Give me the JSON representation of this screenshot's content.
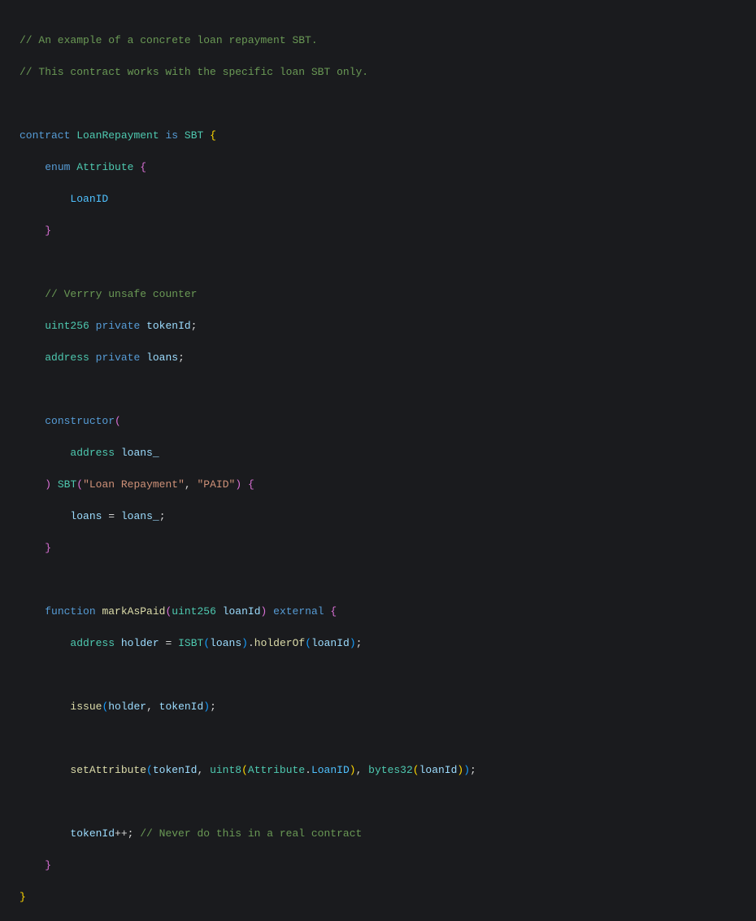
{
  "lines": {
    "c1": "// An example of a concrete loan repayment SBT.",
    "c2": "// This contract works with the specific loan SBT only.",
    "kw_contract": "contract",
    "type_LoanRepayment": "LoanRepayment",
    "kw_is": "is",
    "type_SBT": "SBT",
    "kw_enum": "enum",
    "type_Attribute": "Attribute",
    "enum_LoanID": "LoanID",
    "c3": "// Verrry unsafe counter",
    "type_uint256": "uint256",
    "kw_private": "private",
    "var_tokenId": "tokenId",
    "type_address": "address",
    "var_loans": "loans",
    "kw_constructor": "constructor",
    "param_loans_": "loans_",
    "str_name": "\"Loan Repayment\"",
    "str_symbol": "\"PAID\"",
    "kw_function": "function",
    "func_markAsPaid": "markAsPaid",
    "param_loanId": "loanId",
    "kw_external": "external",
    "var_holder": "holder",
    "type_ISBT": "ISBT",
    "func_holderOf": "holderOf",
    "func_issue": "issue",
    "func_setAttribute": "setAttribute",
    "type_uint8": "uint8",
    "type_bytes32": "bytes32",
    "c4": "// Never do this in a real contract"
  }
}
